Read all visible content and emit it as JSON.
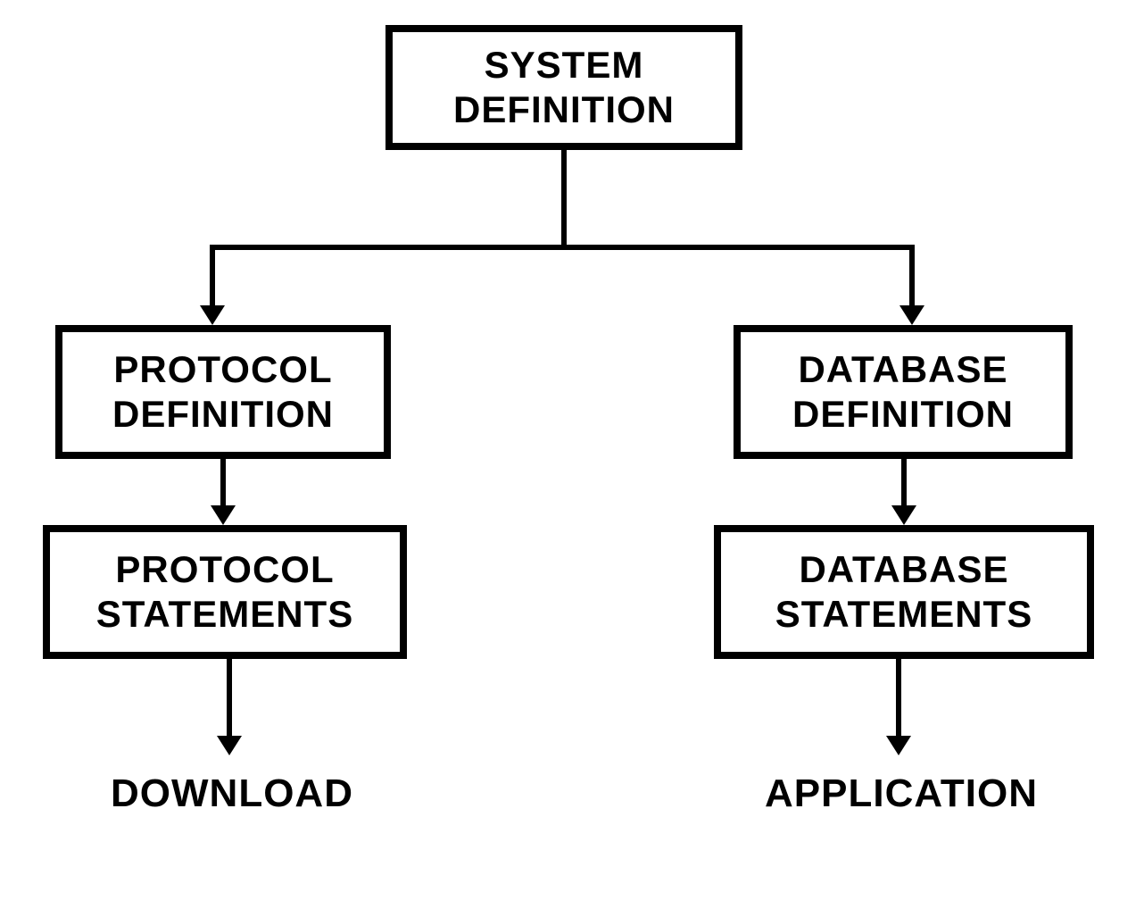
{
  "nodes": {
    "system_definition": {
      "line1": "SYSTEM",
      "line2": "DEFINITION"
    },
    "protocol_definition": {
      "line1": "PROTOCOL",
      "line2": "DEFINITION"
    },
    "database_definition": {
      "line1": "DATABASE",
      "line2": "DEFINITION"
    },
    "protocol_statements": {
      "line1": "PROTOCOL",
      "line2": "STATEMENTS"
    },
    "database_statements": {
      "line1": "DATABASE",
      "line2": "STATEMENTS"
    }
  },
  "terminals": {
    "download": "DOWNLOAD",
    "application": "APPLICATION"
  },
  "style": {
    "border_color": "#000000",
    "font_size_box": "42px",
    "font_size_terminal": "44px"
  }
}
